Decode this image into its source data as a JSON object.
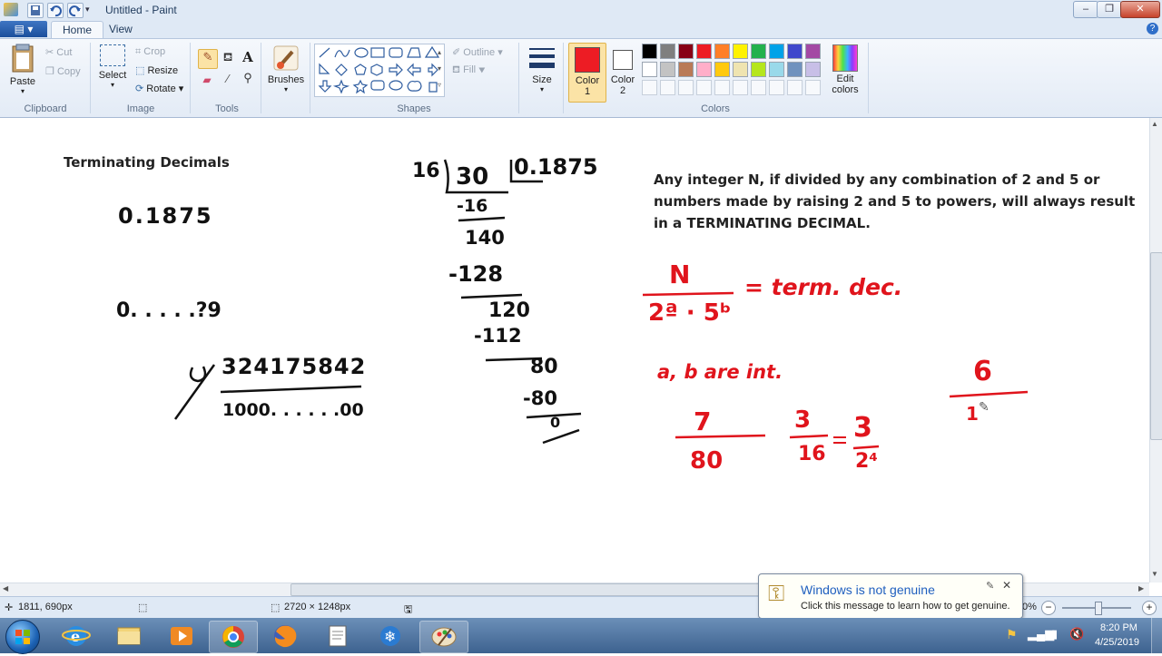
{
  "window": {
    "title": "Untitled - Paint",
    "controls": [
      "minimize",
      "maximize",
      "close"
    ]
  },
  "ribbon": {
    "tabs": [
      {
        "label": "Home",
        "active": true
      },
      {
        "label": "View",
        "active": false
      }
    ],
    "clipboard": {
      "paste": "Paste",
      "cut": "Cut",
      "copy": "Copy",
      "group": "Clipboard"
    },
    "image": {
      "select": "Select",
      "crop": "Crop",
      "resize": "Resize",
      "rotate": "Rotate",
      "group": "Image"
    },
    "tools": {
      "group": "Tools"
    },
    "brushes": {
      "label": "Brushes"
    },
    "shapes": {
      "outline": "Outline",
      "fill": "Fill",
      "group": "Shapes"
    },
    "size": {
      "label": "Size"
    },
    "colors": {
      "color1_label": "Color",
      "color1_num": "1",
      "color2_label": "Color",
      "color2_num": "2",
      "color1": "#ed1c24",
      "color2": "#ffffff",
      "edit_line1": "Edit",
      "edit_line2": "colors",
      "group": "Colors",
      "palette_row1": [
        "#000000",
        "#7f7f7f",
        "#880015",
        "#ed1c24",
        "#ff7f27",
        "#fff200",
        "#22b14c",
        "#00a2e8",
        "#3f48cc",
        "#a349a4"
      ],
      "palette_row2": [
        "#ffffff",
        "#c3c3c3",
        "#b97a57",
        "#ffaec9",
        "#ffc90e",
        "#efe4b0",
        "#b5e61d",
        "#99d9ea",
        "#7092be",
        "#c8bfe7"
      ]
    }
  },
  "canvas": {
    "heading": "Terminating Decimals",
    "paragraph": [
      "Any integer N, if divided by any combination of 2 and 5 or",
      "numbers made by raising 2 and 5 to powers, will always result",
      "in a TERMINATING DECIMAL."
    ],
    "handwriting": {
      "decimal1": "0.1875",
      "decimal2": "0. . . . .?9",
      "numerator_big": "324175842",
      "denominator_big": "1000. . . . . .00",
      "div_divisor": "16",
      "div_dividend": "30",
      "div_quotient": "0.1875",
      "div_steps": [
        "-16",
        "140",
        "-128",
        "120",
        "-112",
        "80",
        "-80",
        "0"
      ],
      "formula_num": "N",
      "formula_den": "2ª · 5ᵇ",
      "formula_rhs": "= term. dec.",
      "ab_note": "a, b are int.",
      "frac1_num": "7",
      "frac1_den": "80",
      "frac2_num": "3",
      "frac2_den": "16",
      "frac3_num": "3",
      "frac3_den": "2⁴",
      "frac4_num": "6",
      "frac4_den": "1"
    }
  },
  "statusbar": {
    "cursor_pos": "1811, 690px",
    "image_size": "2720 × 1248px",
    "zoom": "0%"
  },
  "notification": {
    "title": "Windows is not genuine",
    "message": "Click this message to learn how to get genuine."
  },
  "taskbar": {
    "time": "8:20 PM",
    "date": "4/25/2019",
    "apps": [
      "start-button",
      "internet-explorer-icon",
      "file-explorer-icon",
      "media-player-icon",
      "chrome-icon",
      "firefox-icon",
      "document-icon",
      "snowflake-app-icon",
      "paint-icon"
    ]
  }
}
